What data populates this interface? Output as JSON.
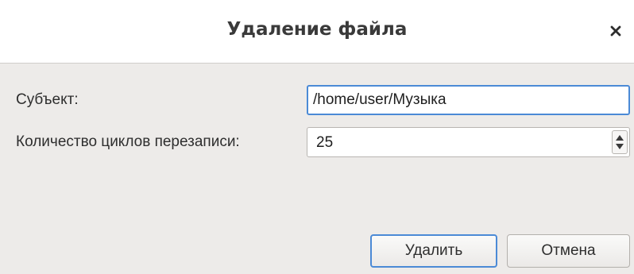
{
  "window": {
    "title": "Удаление файла",
    "close_icon": "close-icon"
  },
  "form": {
    "subject_label": "Субъект:",
    "subject_value": "/home/user/Музыка",
    "cycles_label": "Количество циклов перезаписи:",
    "cycles_value": "25"
  },
  "buttons": {
    "delete_label": "Удалить",
    "cancel_label": "Отмена"
  },
  "colors": {
    "focus_accent": "#4b8ad6",
    "dialog_bg": "#edebe9",
    "titlebar_bg": "#ffffff"
  }
}
